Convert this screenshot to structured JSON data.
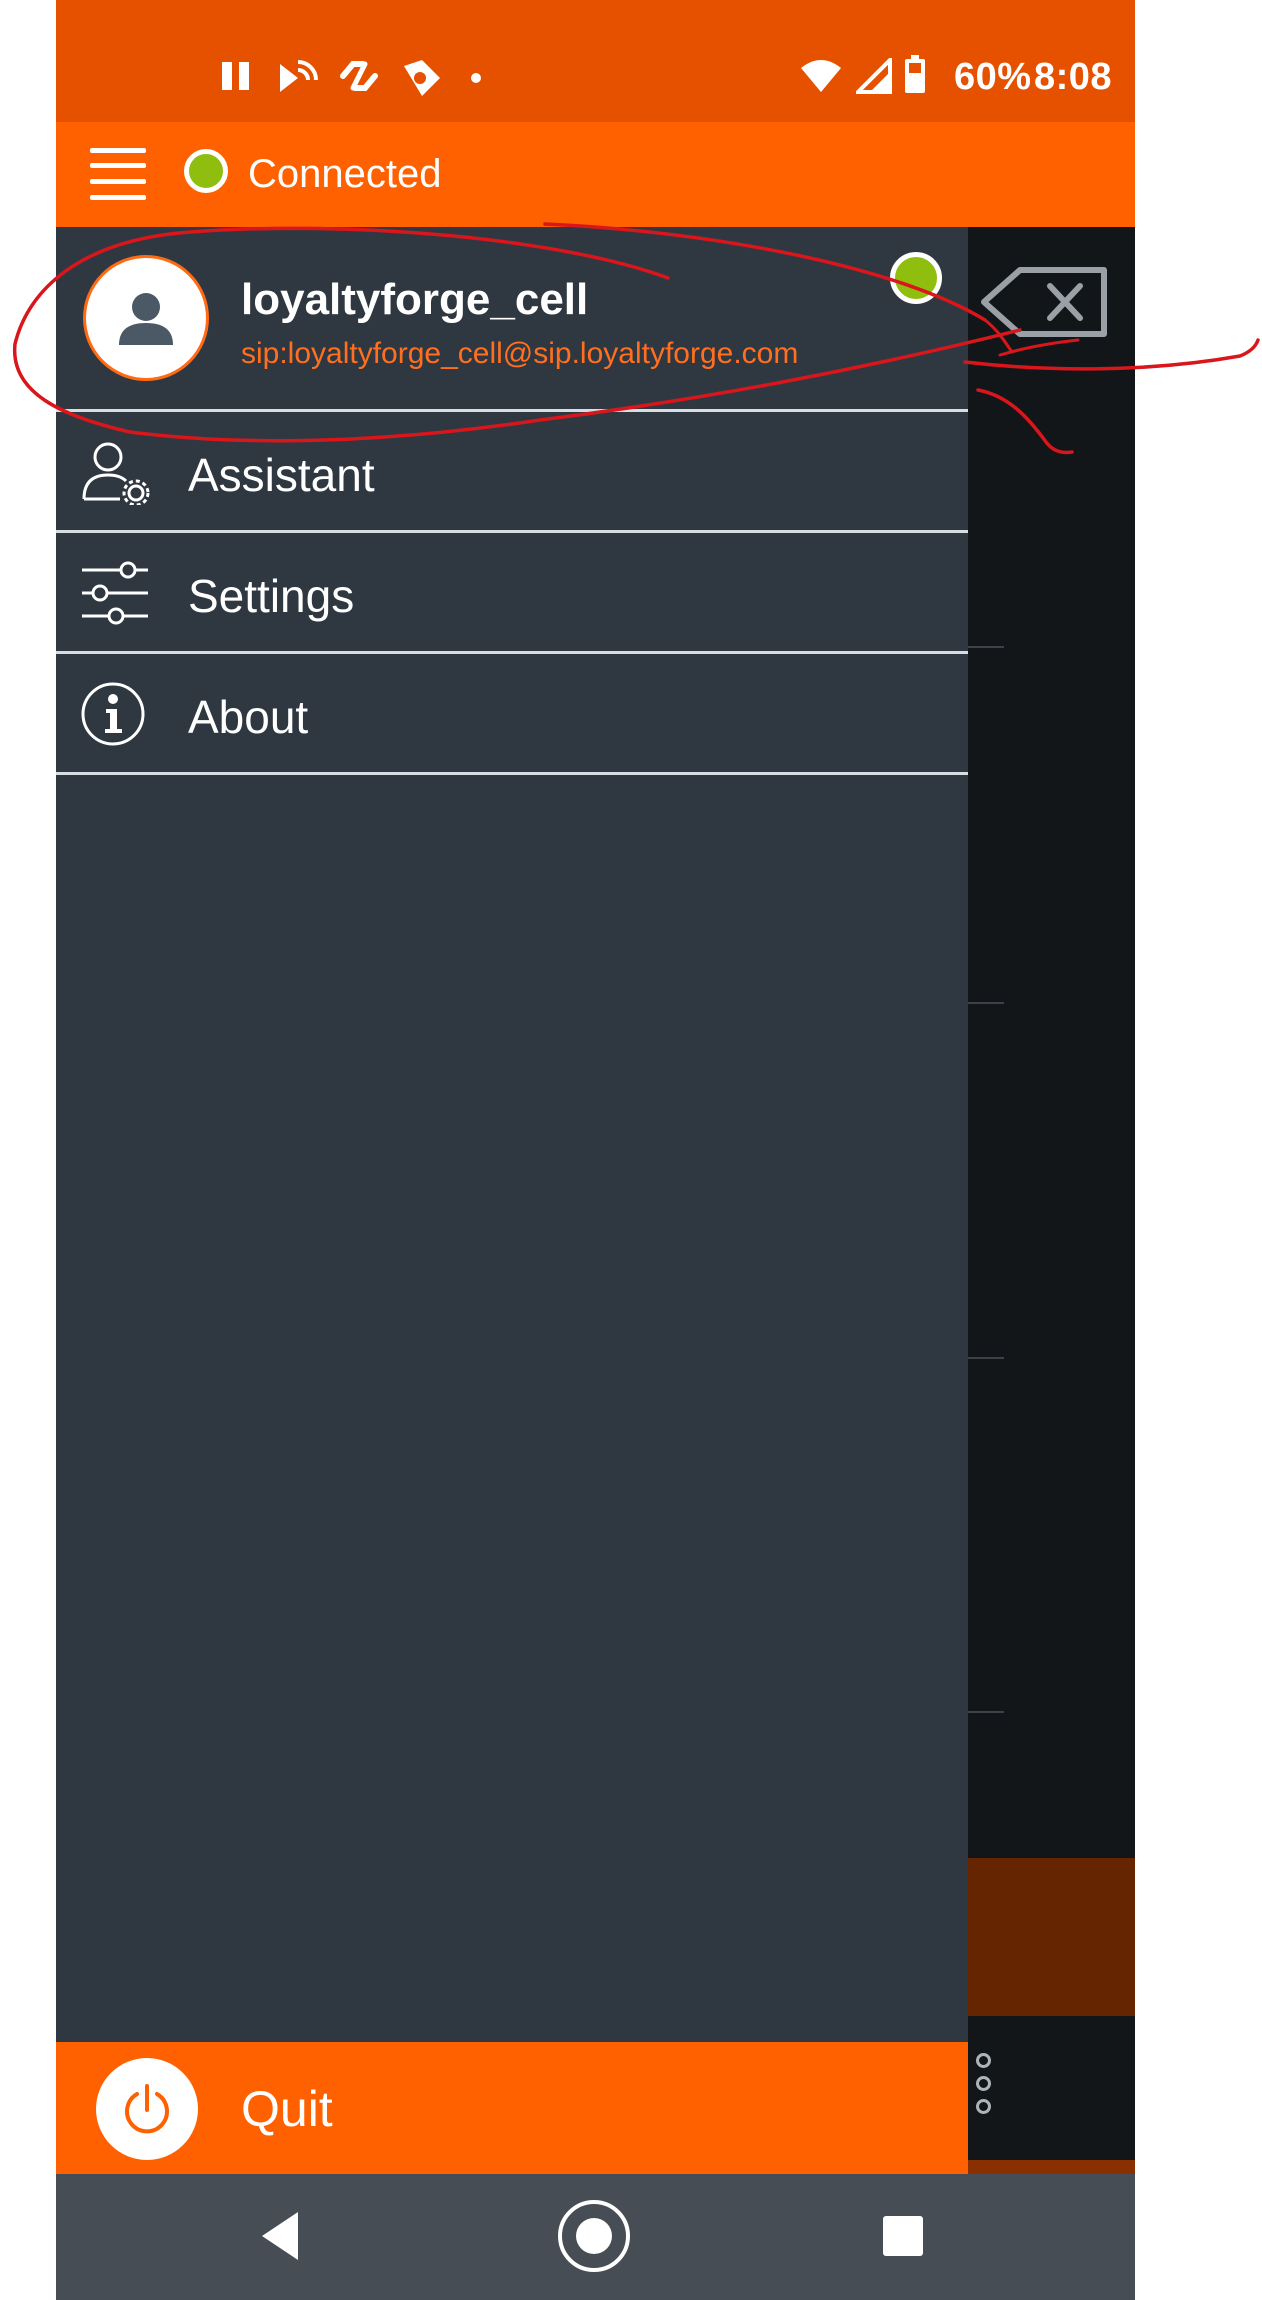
{
  "status_bar": {
    "battery": "60%",
    "time": "8:08",
    "left_icons": [
      "pause-icon",
      "cast-icon",
      "sync-icon",
      "phone-tag-icon",
      "dot-icon"
    ],
    "right_icons": [
      "wifi-icon",
      "cellular-icon",
      "battery-icon"
    ]
  },
  "app_bar": {
    "connection_status": "Connected",
    "menu_icon": "hamburger-icon",
    "status_color": "#8fbe0f"
  },
  "drawer": {
    "profile": {
      "username": "loyaltyforge_cell",
      "sip_address": "sip:loyaltyforge_cell@sip.loyaltyforge.com",
      "presence_color": "#8fbe0f"
    },
    "items": [
      {
        "label": "Assistant",
        "icon": "assistant-icon"
      },
      {
        "label": "Settings",
        "icon": "settings-sliders-icon"
      },
      {
        "label": "About",
        "icon": "info-icon"
      }
    ],
    "quit": {
      "label": "Quit",
      "icon": "power-icon"
    }
  },
  "nav_bar": {
    "buttons": [
      "back-icon",
      "home-icon",
      "recents-icon"
    ]
  },
  "colors": {
    "brand_orange": "#ff6000",
    "status_bar": "#e65100",
    "drawer_bg": "#2f3841",
    "sip_text": "#ff6f1f",
    "annotation": "#d8161b"
  }
}
